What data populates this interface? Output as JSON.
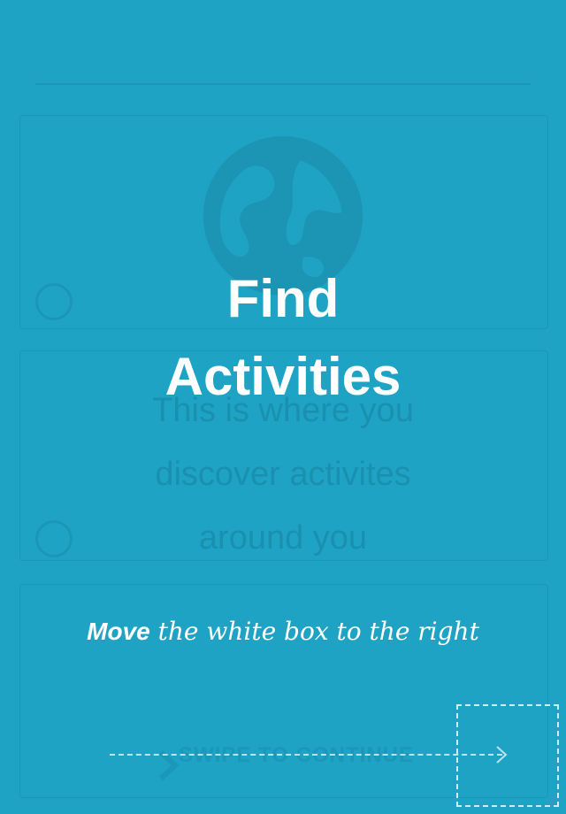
{
  "tutorial": {
    "title_line1": "Find",
    "title_line2": "Activities",
    "description_line1": "This is where you",
    "description_line2": "discover activites",
    "description_line3": "around you",
    "instruction_strong": "Move",
    "instruction_rest": " the white box to the right",
    "swipe_label": "SWIPE TO CONTINUE"
  },
  "colors": {
    "background": "#1fa3c4",
    "text": "#ffffff"
  },
  "icons": {
    "background_globe": "globe-icon",
    "swipe_chevron": "chevron-right-icon",
    "dashed_arrow": "arrow-right-icon"
  }
}
